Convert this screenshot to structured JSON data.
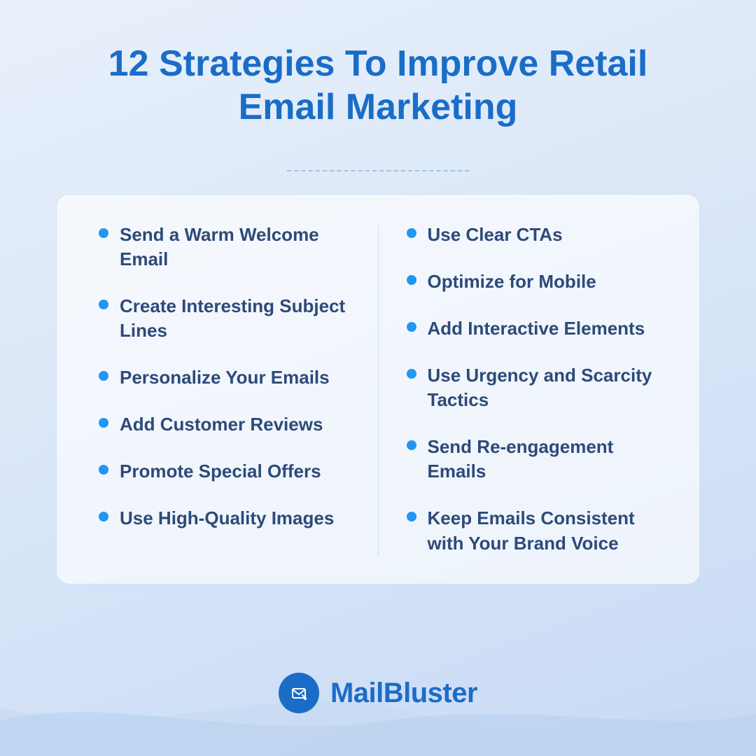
{
  "page": {
    "background_color": "#e8f0fb",
    "title_line1": "12 Strategies To Improve Retail",
    "title_line2": "Email Marketing"
  },
  "left_column": {
    "items": [
      {
        "text": "Send a Warm Welcome Email"
      },
      {
        "text": "Create Interesting Subject Lines"
      },
      {
        "text": "Personalize Your Emails"
      },
      {
        "text": "Add Customer Reviews"
      },
      {
        "text": "Promote Special Offers"
      },
      {
        "text": "Use High-Quality Images"
      }
    ]
  },
  "right_column": {
    "items": [
      {
        "text": "Use Clear CTAs"
      },
      {
        "text": "Optimize for Mobile"
      },
      {
        "text": "Add Interactive Elements"
      },
      {
        "text": "Use Urgency and Scarcity Tactics"
      },
      {
        "text": "Send Re-engagement Emails"
      },
      {
        "text": "Keep Emails Consistent with Your Brand Voice"
      }
    ]
  },
  "brand": {
    "name": "MailBluster",
    "logo_icon": "✉"
  }
}
